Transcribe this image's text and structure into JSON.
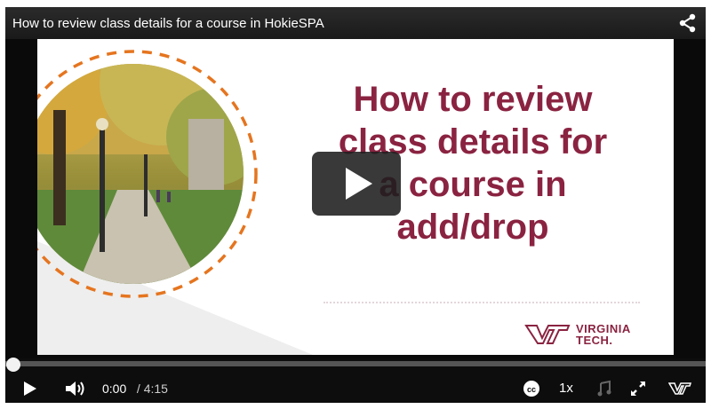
{
  "video": {
    "title": "How to review class details for a course in HokieSPA"
  },
  "slide": {
    "title_lines": [
      "How to review",
      "class details for",
      "a course in",
      "add/drop"
    ],
    "logo_line1": "VIRGINIA",
    "logo_line2": "TECH.",
    "colors": {
      "maroon": "#8a2341",
      "orange": "#e5751f"
    }
  },
  "controls": {
    "current_time": "0:00",
    "separator": "/",
    "duration": "4:15",
    "playback_rate": "1x",
    "progress": 0
  },
  "icons": [
    "share-icon",
    "play-icon",
    "volume-icon",
    "closed-captions-icon",
    "music-note-icon",
    "fullscreen-icon",
    "vt-logo-icon"
  ]
}
